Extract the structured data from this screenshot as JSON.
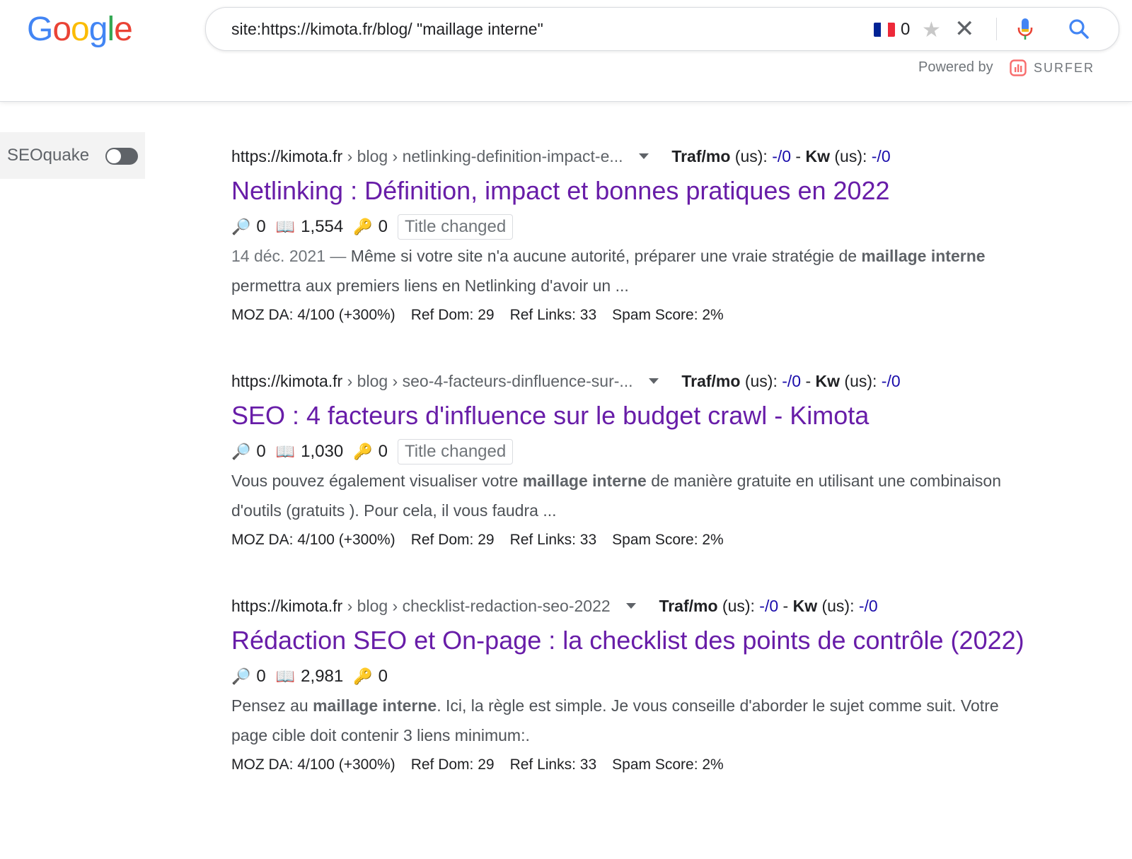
{
  "logo": [
    "G",
    "o",
    "o",
    "g",
    "l",
    "e"
  ],
  "logo_colors": [
    "#4285F4",
    "#EA4335",
    "#FBBC05",
    "#4285F4",
    "#34A853",
    "#EA4335"
  ],
  "search": {
    "query": "site:https://kimota.fr/blog/ \"maillage interne\"",
    "flag_count": "0",
    "powered_by": "Powered by",
    "surfer": "SURFER"
  },
  "sidebar": {
    "seoquake_label": "SEOquake",
    "seoquake_enabled": false
  },
  "colors": {
    "title_link": "#681da8",
    "traffic_value": "#1a0dab",
    "surfer_accent": "#f86d6d"
  },
  "results": [
    {
      "domain": "https://kimota.fr",
      "crumb_mid": "blog",
      "crumb_end": "netlinking-definition-impact-e...",
      "traf_label": "Traf/mo",
      "us1": " (us): ",
      "traf_val": "-/0",
      "dash": " - ",
      "kw_label": "Kw",
      "us2": " (us): ",
      "kw_val": "-/0",
      "title": "Netlinking : Définition, impact et bonnes pratiques en 2022",
      "m1": "0",
      "m2": "1,554",
      "m3": "0",
      "badge": "Title changed",
      "date": "14 déc. 2021 — ",
      "s1": "Même si votre site n'a aucune autorité, préparer une vraie stratégie de ",
      "b1": "maillage interne",
      "s2": " permettra aux premiers liens en Netlinking d'avoir un ...",
      "moz": "MOZ DA: 4/100 (+300%)",
      "refdom": "Ref Dom: 29",
      "reflinks": "Ref Links: 33",
      "spam": "Spam Score: 2%"
    },
    {
      "domain": "https://kimota.fr",
      "crumb_mid": "blog",
      "crumb_end": "seo-4-facteurs-dinfluence-sur-...",
      "traf_label": "Traf/mo",
      "us1": " (us): ",
      "traf_val": "-/0",
      "dash": " - ",
      "kw_label": "Kw",
      "us2": " (us): ",
      "kw_val": "-/0",
      "title": "SEO : 4 facteurs d'influence sur le budget crawl - Kimota",
      "m1": "0",
      "m2": "1,030",
      "m3": "0",
      "badge": "Title changed",
      "s1": "Vous pouvez également visualiser votre ",
      "b1": "maillage interne",
      "s2": " de manière gratuite en utilisant une combinaison d'outils (gratuits ). Pour cela, il vous faudra ...",
      "moz": "MOZ DA: 4/100 (+300%)",
      "refdom": "Ref Dom: 29",
      "reflinks": "Ref Links: 33",
      "spam": "Spam Score: 2%"
    },
    {
      "domain": "https://kimota.fr",
      "crumb_mid": "blog",
      "crumb_end": "checklist-redaction-seo-2022",
      "traf_label": "Traf/mo",
      "us1": " (us): ",
      "traf_val": "-/0",
      "dash": " - ",
      "kw_label": "Kw",
      "us2": " (us): ",
      "kw_val": "-/0",
      "title": "Rédaction SEO et On-page : la checklist des points de contrôle (2022)",
      "m1": "0",
      "m2": "2,981",
      "m3": "0",
      "s1": "Pensez au ",
      "b1": "maillage interne",
      "s2": ". Ici, la règle est simple. Je vous conseille d'aborder le sujet comme suit. Votre page cible doit contenir 3 liens minimum:.",
      "moz": "MOZ DA: 4/100 (+300%)",
      "refdom": "Ref Dom: 29",
      "reflinks": "Ref Links: 33",
      "spam": "Spam Score: 2%"
    }
  ]
}
